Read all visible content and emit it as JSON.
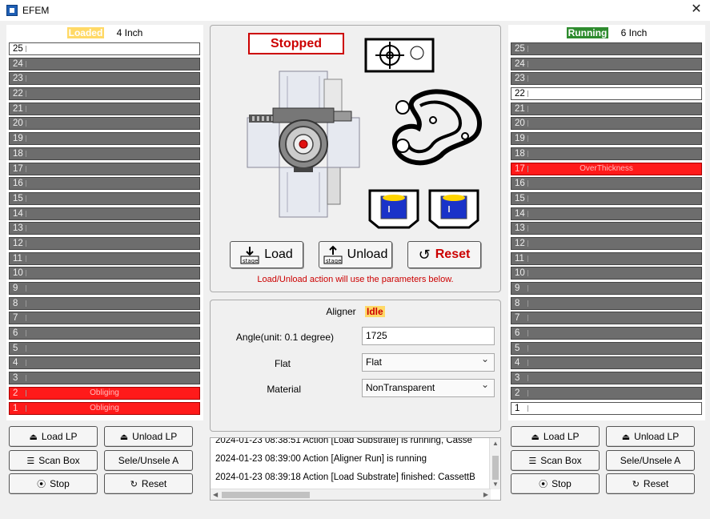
{
  "window": {
    "title": "EFEM"
  },
  "left_port": {
    "status": "Loaded",
    "size": "4 Inch",
    "slots": [
      {
        "num": "25",
        "state": "wafer",
        "msg": ""
      },
      {
        "num": "24",
        "state": "empty",
        "msg": ""
      },
      {
        "num": "23",
        "state": "empty",
        "msg": ""
      },
      {
        "num": "22",
        "state": "empty",
        "msg": ""
      },
      {
        "num": "21",
        "state": "empty",
        "msg": ""
      },
      {
        "num": "20",
        "state": "empty",
        "msg": ""
      },
      {
        "num": "19",
        "state": "empty",
        "msg": ""
      },
      {
        "num": "18",
        "state": "empty",
        "msg": ""
      },
      {
        "num": "17",
        "state": "empty",
        "msg": ""
      },
      {
        "num": "16",
        "state": "empty",
        "msg": ""
      },
      {
        "num": "15",
        "state": "empty",
        "msg": ""
      },
      {
        "num": "14",
        "state": "empty",
        "msg": ""
      },
      {
        "num": "13",
        "state": "empty",
        "msg": ""
      },
      {
        "num": "12",
        "state": "empty",
        "msg": ""
      },
      {
        "num": "11",
        "state": "empty",
        "msg": ""
      },
      {
        "num": "10",
        "state": "empty",
        "msg": ""
      },
      {
        "num": "9",
        "state": "empty",
        "msg": ""
      },
      {
        "num": "8",
        "state": "empty",
        "msg": ""
      },
      {
        "num": "7",
        "state": "empty",
        "msg": ""
      },
      {
        "num": "6",
        "state": "empty",
        "msg": ""
      },
      {
        "num": "5",
        "state": "empty",
        "msg": ""
      },
      {
        "num": "4",
        "state": "empty",
        "msg": ""
      },
      {
        "num": "3",
        "state": "empty",
        "msg": ""
      },
      {
        "num": "2",
        "state": "error",
        "msg": "Obliging"
      },
      {
        "num": "1",
        "state": "error",
        "msg": "Obliging"
      }
    ],
    "buttons": {
      "load_lp": "Load LP",
      "unload_lp": "Unload LP",
      "scan_box": "Scan Box",
      "sele_unsele": "Sele/Unsele A",
      "stop": "Stop",
      "reset": "Reset"
    }
  },
  "right_port": {
    "status": "Running",
    "size": "6 Inch",
    "slots": [
      {
        "num": "25",
        "state": "empty",
        "msg": ""
      },
      {
        "num": "24",
        "state": "empty",
        "msg": ""
      },
      {
        "num": "23",
        "state": "empty",
        "msg": ""
      },
      {
        "num": "22",
        "state": "wafer",
        "msg": ""
      },
      {
        "num": "21",
        "state": "empty",
        "msg": ""
      },
      {
        "num": "20",
        "state": "empty",
        "msg": ""
      },
      {
        "num": "19",
        "state": "empty",
        "msg": ""
      },
      {
        "num": "18",
        "state": "empty",
        "msg": ""
      },
      {
        "num": "17",
        "state": "error",
        "msg": "OverThickness"
      },
      {
        "num": "16",
        "state": "empty",
        "msg": ""
      },
      {
        "num": "15",
        "state": "empty",
        "msg": ""
      },
      {
        "num": "14",
        "state": "empty",
        "msg": ""
      },
      {
        "num": "13",
        "state": "empty",
        "msg": ""
      },
      {
        "num": "12",
        "state": "empty",
        "msg": ""
      },
      {
        "num": "11",
        "state": "empty",
        "msg": ""
      },
      {
        "num": "10",
        "state": "empty",
        "msg": ""
      },
      {
        "num": "9",
        "state": "empty",
        "msg": ""
      },
      {
        "num": "8",
        "state": "empty",
        "msg": ""
      },
      {
        "num": "7",
        "state": "empty",
        "msg": ""
      },
      {
        "num": "6",
        "state": "empty",
        "msg": ""
      },
      {
        "num": "5",
        "state": "empty",
        "msg": ""
      },
      {
        "num": "4",
        "state": "empty",
        "msg": ""
      },
      {
        "num": "3",
        "state": "empty",
        "msg": ""
      },
      {
        "num": "2",
        "state": "empty",
        "msg": ""
      },
      {
        "num": "1",
        "state": "wafer",
        "msg": ""
      }
    ],
    "buttons": {
      "load_lp": "Load LP",
      "unload_lp": "Unload LP",
      "scan_box": "Scan Box",
      "sele_unsele": "Sele/Unsele A",
      "stop": "Stop",
      "reset": "Reset"
    }
  },
  "robot": {
    "status": "Stopped",
    "load_label": "Load",
    "unload_label": "Unload",
    "reset_label": "Reset",
    "stage_label": "stage",
    "note": "Load/Unload action will use the parameters below."
  },
  "aligner": {
    "title": "Aligner",
    "status": "Idle",
    "angle_label": "Angle(unit:  0.1 degree)",
    "angle_value": "1725",
    "flat_label": "Flat",
    "flat_value": "Flat",
    "material_label": "Material",
    "material_value": "NonTransparent"
  },
  "log": [
    "2024-01-23 08:38:51   Action [Load Substrate] is running,  Casse",
    "2024-01-23 08:39:00   Action [Aligner Run] is running",
    "2024-01-23 08:39:18   Action [Load Substrate] finished: CassettB"
  ],
  "colors": {
    "slot_empty": "#6d6d6d",
    "slot_error": "#ff1a1a",
    "status_red": "#cc0000",
    "running_green": "#2e8b2e",
    "loaded_yellow": "#ffd966"
  }
}
